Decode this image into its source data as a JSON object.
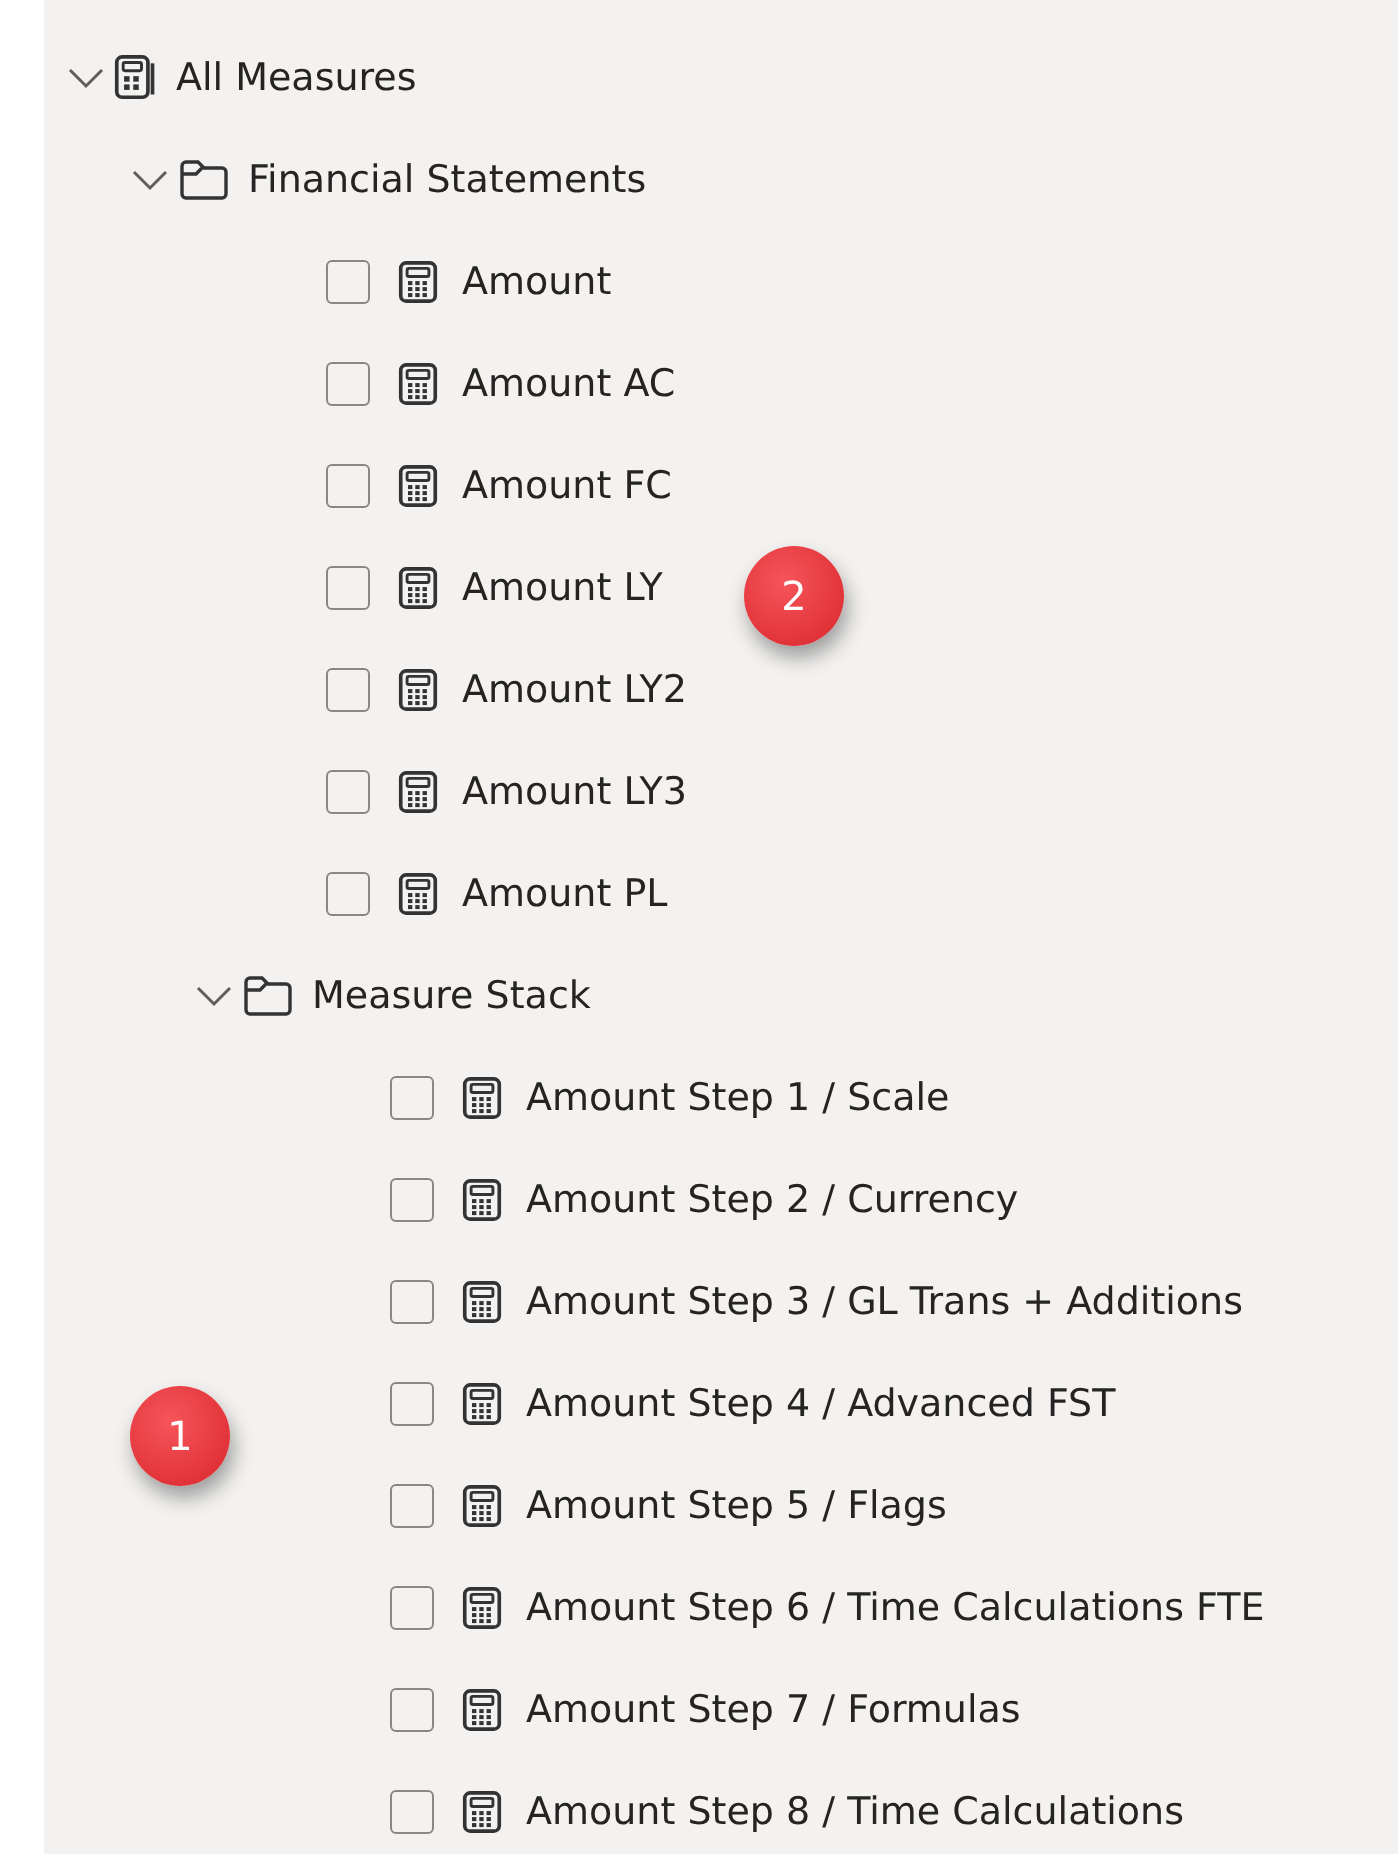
{
  "tree": [
    {
      "kind": "model",
      "label": "All Measures",
      "expanded": true,
      "children": [
        {
          "kind": "folder",
          "label": "Financial Statements",
          "expanded": true,
          "children": [
            {
              "kind": "measure",
              "label": "Amount",
              "checked": false
            },
            {
              "kind": "measure",
              "label": "Amount AC",
              "checked": false
            },
            {
              "kind": "measure",
              "label": "Amount FC",
              "checked": false
            },
            {
              "kind": "measure",
              "label": "Amount LY",
              "checked": false
            },
            {
              "kind": "measure",
              "label": "Amount LY2",
              "checked": false
            },
            {
              "kind": "measure",
              "label": "Amount LY3",
              "checked": false
            },
            {
              "kind": "measure",
              "label": "Amount PL",
              "checked": false
            },
            {
              "kind": "folder",
              "label": "Measure Stack",
              "expanded": true,
              "children": [
                {
                  "kind": "measure",
                  "label": "Amount Step 1 / Scale",
                  "checked": false
                },
                {
                  "kind": "measure",
                  "label": "Amount Step 2 / Currency",
                  "checked": false
                },
                {
                  "kind": "measure",
                  "label": "Amount Step 3 / GL Trans + Additions",
                  "checked": false
                },
                {
                  "kind": "measure",
                  "label": "Amount Step 4 / Advanced FST",
                  "checked": false
                },
                {
                  "kind": "measure",
                  "label": "Amount Step 5 / Flags",
                  "checked": false
                },
                {
                  "kind": "measure",
                  "label": "Amount Step 6 / Time Calculations FTE",
                  "checked": false
                },
                {
                  "kind": "measure",
                  "label": "Amount Step 7 / Formulas",
                  "checked": false
                },
                {
                  "kind": "measure",
                  "label": "Amount Step 8 / Time Calculations",
                  "checked": false
                }
              ]
            }
          ]
        }
      ]
    }
  ],
  "callouts": [
    {
      "text": "2"
    },
    {
      "text": "1"
    }
  ]
}
